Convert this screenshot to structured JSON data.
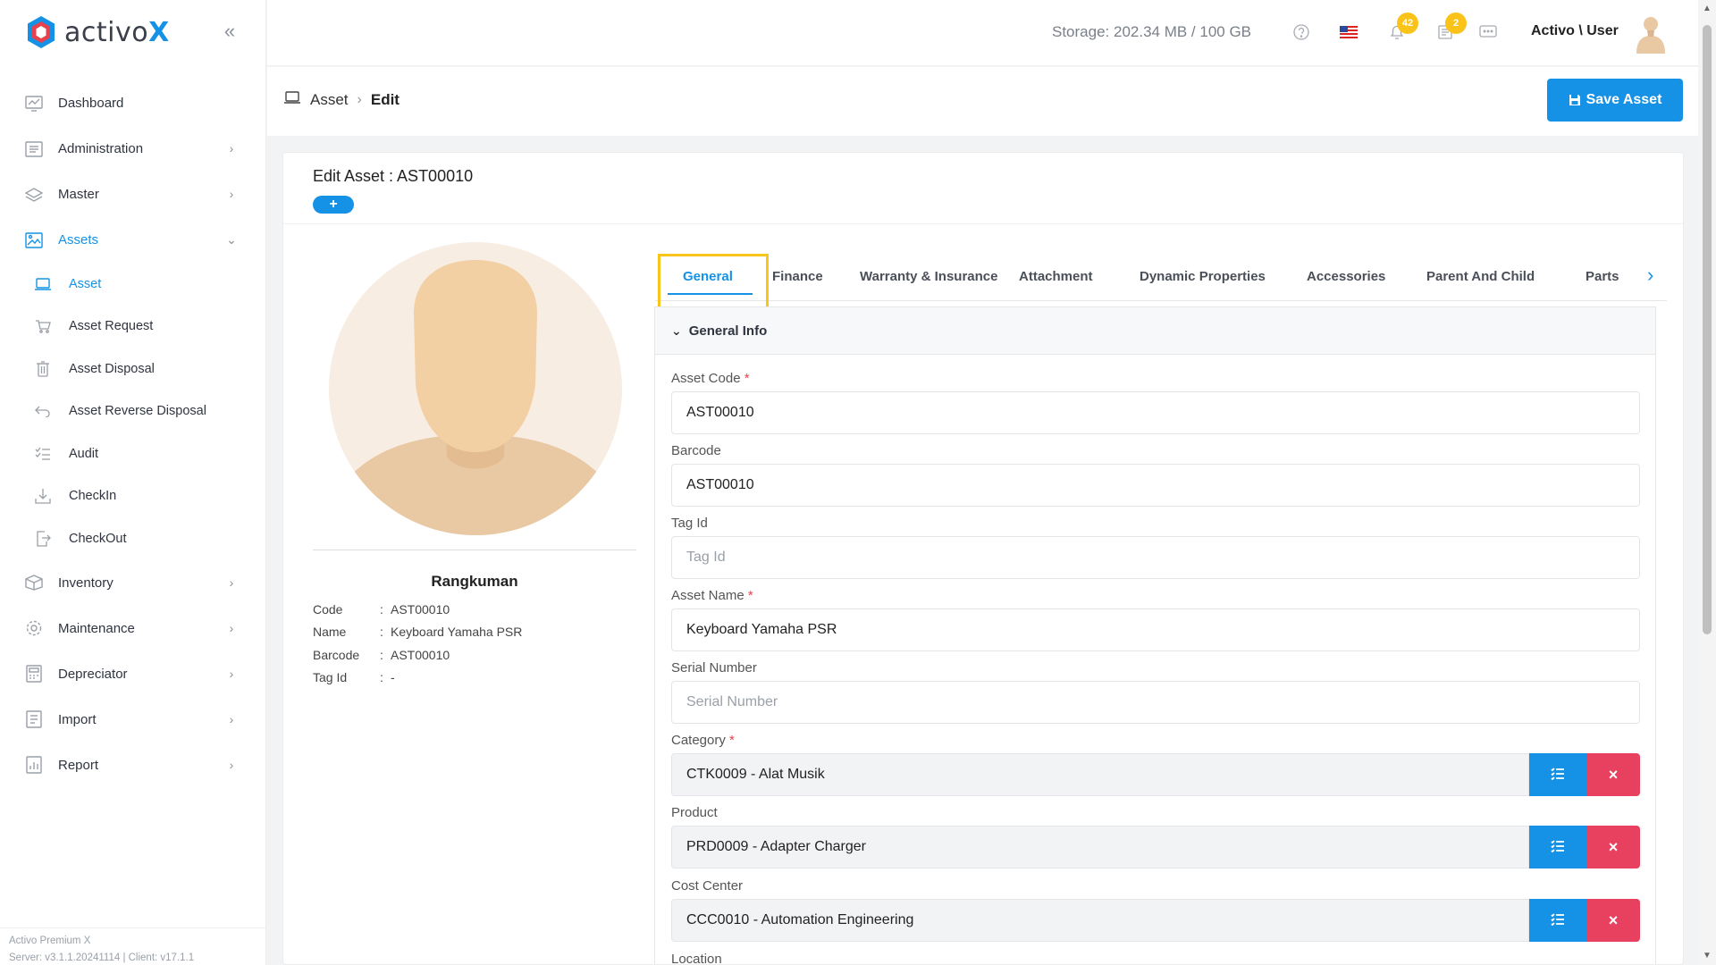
{
  "brand": {
    "name_prefix": "activo",
    "name_suffix": "X"
  },
  "sidebar": {
    "items": [
      {
        "label": "Dashboard",
        "icon": "chart-icon"
      },
      {
        "label": "Administration",
        "icon": "list-icon"
      },
      {
        "label": "Master",
        "icon": "layers-icon"
      },
      {
        "label": "Assets",
        "icon": "image-icon"
      }
    ],
    "sub_items": [
      {
        "label": "Asset",
        "icon": "laptop-icon"
      },
      {
        "label": "Asset Request",
        "icon": "cart-icon"
      },
      {
        "label": "Asset Disposal",
        "icon": "trash-icon"
      },
      {
        "label": "Asset Reverse Disposal",
        "icon": "undo-icon"
      },
      {
        "label": "Audit",
        "icon": "checklist-icon"
      },
      {
        "label": "CheckIn",
        "icon": "download-icon"
      },
      {
        "label": "CheckOut",
        "icon": "export-icon"
      }
    ],
    "lower_items": [
      {
        "label": "Inventory",
        "icon": "box-icon"
      },
      {
        "label": "Maintenance",
        "icon": "gear-icon"
      },
      {
        "label": "Depreciator",
        "icon": "calculator-icon"
      },
      {
        "label": "Import",
        "icon": "import-icon"
      },
      {
        "label": "Report",
        "icon": "report-icon"
      }
    ],
    "footer_line1": "Activo Premium X",
    "footer_line2": "Server: v3.1.1.20241114 | Client: v17.1.1"
  },
  "topbar": {
    "storage": "Storage: 202.34 MB / 100 GB",
    "notif_count": "42",
    "task_count": "2",
    "user": "Activo \\ User"
  },
  "breadcrumb": {
    "root": "Asset",
    "current": "Edit"
  },
  "save_label": "Save Asset",
  "card": {
    "title": "Edit Asset : AST00010",
    "add_label": "+"
  },
  "summary": {
    "title": "Rangkuman",
    "rows": [
      {
        "k": "Code",
        "v": "AST00010"
      },
      {
        "k": "Name",
        "v": "Keyboard Yamaha PSR"
      },
      {
        "k": "Barcode",
        "v": "AST00010"
      },
      {
        "k": "Tag Id",
        "v": "-"
      }
    ]
  },
  "tabs": [
    "General",
    "Finance",
    "Warranty & Insurance",
    "Attachment",
    "Dynamic Properties",
    "Accessories",
    "Parent And Child",
    "Parts"
  ],
  "panel": {
    "title": "General Info"
  },
  "form": {
    "asset_code": {
      "label": "Asset Code",
      "value": "AST00010"
    },
    "barcode": {
      "label": "Barcode",
      "value": "AST00010"
    },
    "tag_id": {
      "label": "Tag Id",
      "placeholder": "Tag Id"
    },
    "asset_name": {
      "label": "Asset Name",
      "value": "Keyboard Yamaha PSR"
    },
    "serial_number": {
      "label": "Serial Number",
      "placeholder": "Serial Number"
    },
    "category": {
      "label": "Category",
      "value": "CTK0009 - Alat Musik"
    },
    "product": {
      "label": "Product",
      "value": "PRD0009 - Adapter Charger"
    },
    "cost_center": {
      "label": "Cost Center",
      "value": "CCC0010 - Automation Engineering"
    },
    "location": {
      "label": "Location"
    }
  },
  "colors": {
    "accent": "#1592e6",
    "danger": "#e8415f",
    "badge": "#f9c31a",
    "highlight": "#f8c51a"
  }
}
